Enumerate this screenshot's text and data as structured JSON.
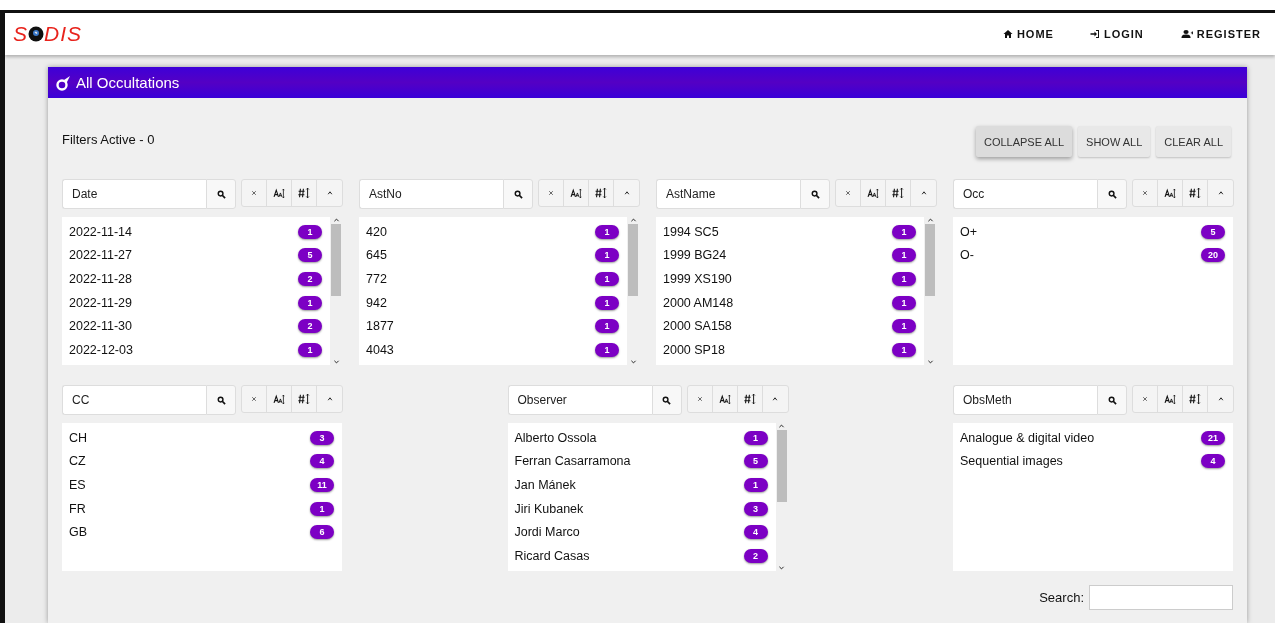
{
  "brand": {
    "logo_before": "S",
    "logo_after": "DIS"
  },
  "nav": [
    {
      "label": "HOME",
      "kind": "home"
    },
    {
      "label": "LOGIN",
      "kind": "login"
    },
    {
      "label": "REGISTER",
      "kind": "register"
    }
  ],
  "panel": {
    "title": "All Occultations",
    "filters_status": "Filters Active - 0",
    "actions": [
      {
        "label": "COLLAPSE ALL",
        "selected": true
      },
      {
        "label": "SHOW ALL",
        "selected": false
      },
      {
        "label": "CLEAR ALL",
        "selected": false
      }
    ]
  },
  "facet_rows": [
    {
      "facets": [
        {
          "placeholder": "Date",
          "scrollable": true,
          "items": [
            {
              "label": "2022-11-14",
              "count": "1"
            },
            {
              "label": "2022-11-27",
              "count": "5"
            },
            {
              "label": "2022-11-28",
              "count": "2"
            },
            {
              "label": "2022-11-29",
              "count": "1"
            },
            {
              "label": "2022-11-30",
              "count": "2"
            },
            {
              "label": "2022-12-03",
              "count": "1"
            }
          ]
        },
        {
          "placeholder": "AstNo",
          "scrollable": true,
          "items": [
            {
              "label": "420",
              "count": "1"
            },
            {
              "label": "645",
              "count": "1"
            },
            {
              "label": "772",
              "count": "1"
            },
            {
              "label": "942",
              "count": "1"
            },
            {
              "label": "1877",
              "count": "1"
            },
            {
              "label": "4043",
              "count": "1"
            }
          ]
        },
        {
          "placeholder": "AstName",
          "scrollable": true,
          "items": [
            {
              "label": "1994 SC5",
              "count": "1"
            },
            {
              "label": "1999 BG24",
              "count": "1"
            },
            {
              "label": "1999 XS190",
              "count": "1"
            },
            {
              "label": "2000 AM148",
              "count": "1"
            },
            {
              "label": "2000 SA158",
              "count": "1"
            },
            {
              "label": "2000 SP18",
              "count": "1"
            }
          ]
        },
        {
          "placeholder": "Occ",
          "scrollable": false,
          "items": [
            {
              "label": "O+",
              "count": "5"
            },
            {
              "label": "O-",
              "count": "20"
            }
          ]
        }
      ]
    },
    {
      "facets": [
        {
          "placeholder": "CC",
          "scrollable": false,
          "items": [
            {
              "label": "CH",
              "count": "3"
            },
            {
              "label": "CZ",
              "count": "4"
            },
            {
              "label": "ES",
              "count": "11"
            },
            {
              "label": "FR",
              "count": "1"
            },
            {
              "label": "GB",
              "count": "6"
            }
          ]
        },
        {
          "placeholder": "Observer",
          "scrollable": true,
          "items": [
            {
              "label": "Alberto Ossola",
              "count": "1"
            },
            {
              "label": "Ferran Casarramona",
              "count": "5"
            },
            {
              "label": "Jan Mánek",
              "count": "1"
            },
            {
              "label": "Jiri Kubanek",
              "count": "3"
            },
            {
              "label": "Jordi Marco",
              "count": "4"
            },
            {
              "label": "Ricard Casas",
              "count": "2"
            }
          ]
        },
        {
          "placeholder": "ObsMeth",
          "scrollable": false,
          "items": [
            {
              "label": "Analogue & digital video",
              "count": "21"
            },
            {
              "label": "Sequential images",
              "count": "4"
            }
          ]
        }
      ]
    }
  ],
  "search": {
    "label": "Search:"
  }
}
